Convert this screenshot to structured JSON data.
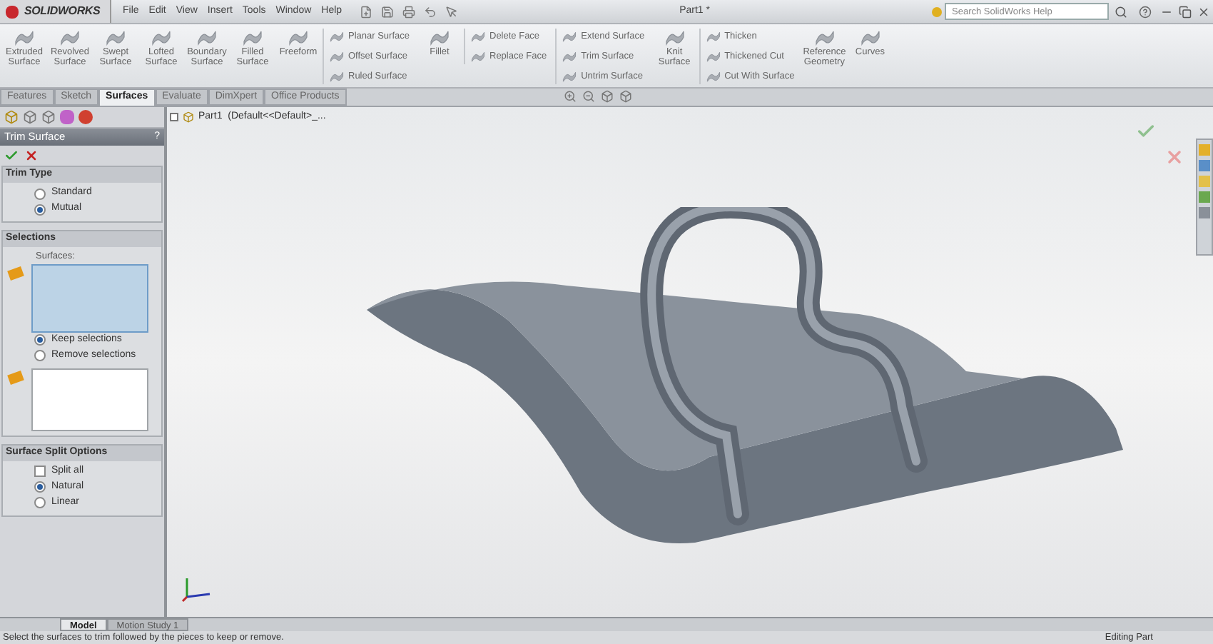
{
  "app": {
    "logo": "SOLIDWORKS"
  },
  "menu": [
    "File",
    "Edit",
    "View",
    "Insert",
    "Tools",
    "Window",
    "Help"
  ],
  "window": {
    "title": "Part1 *"
  },
  "search": {
    "placeholder": "Search SolidWorks Help"
  },
  "ribbon": [
    {
      "kind": "large",
      "label": "Extruded Surface"
    },
    {
      "kind": "large",
      "label": "Revolved Surface"
    },
    {
      "kind": "large",
      "label": "Swept Surface"
    },
    {
      "kind": "large",
      "label": "Lofted Surface"
    },
    {
      "kind": "large",
      "label": "Boundary Surface"
    },
    {
      "kind": "large",
      "label": "Filled Surface"
    },
    {
      "kind": "large",
      "label": "Freeform"
    },
    {
      "kind": "column",
      "items": [
        "Planar Surface",
        "Offset Surface",
        "Ruled Surface"
      ]
    },
    {
      "kind": "large",
      "label": "Fillet"
    },
    {
      "kind": "column",
      "items": [
        "Delete Face",
        "Replace Face"
      ]
    },
    {
      "kind": "column",
      "items": [
        "Extend Surface",
        "Trim Surface",
        "Untrim Surface"
      ]
    },
    {
      "kind": "large",
      "label": "Knit Surface"
    },
    {
      "kind": "column",
      "items": [
        "Thicken",
        "Thickened Cut",
        "Cut With Surface"
      ]
    },
    {
      "kind": "large",
      "label": "Reference Geometry"
    },
    {
      "kind": "large",
      "label": "Curves"
    }
  ],
  "tabs": [
    {
      "label": "Features",
      "selected": false
    },
    {
      "label": "Sketch",
      "selected": false
    },
    {
      "label": "Surfaces",
      "selected": true
    },
    {
      "label": "Evaluate",
      "selected": false
    },
    {
      "label": "DimXpert",
      "selected": false
    },
    {
      "label": "Office Products",
      "selected": false
    }
  ],
  "tree": {
    "root": "Part1  (Default<<Default>_..."
  },
  "panel": {
    "title": "Trim Surface",
    "help": "?",
    "sections": [
      {
        "title": "Trim Type",
        "options": [
          {
            "kind": "radio",
            "label": "Standard",
            "selected": false
          },
          {
            "kind": "radio",
            "label": "Mutual",
            "selected": true
          }
        ]
      },
      {
        "title": "Selections",
        "list_label": "Surfaces:",
        "options": [
          {
            "kind": "radio",
            "label": "Keep selections",
            "selected": true
          },
          {
            "kind": "radio",
            "label": "Remove selections",
            "selected": false
          }
        ]
      },
      {
        "title": "Surface Split Options",
        "options": [
          {
            "kind": "checkbox",
            "label": "Split all",
            "selected": false
          },
          {
            "kind": "radio",
            "label": "Natural",
            "selected": true
          },
          {
            "kind": "radio",
            "label": "Linear",
            "selected": false
          }
        ]
      }
    ]
  },
  "bottom_tabs": [
    {
      "label": "Model",
      "selected": true
    },
    {
      "label": "Motion Study 1",
      "selected": false
    }
  ],
  "status_bar": {
    "message": "Select the surfaces to trim followed by the pieces to keep or remove.",
    "mode": "Editing Part"
  }
}
